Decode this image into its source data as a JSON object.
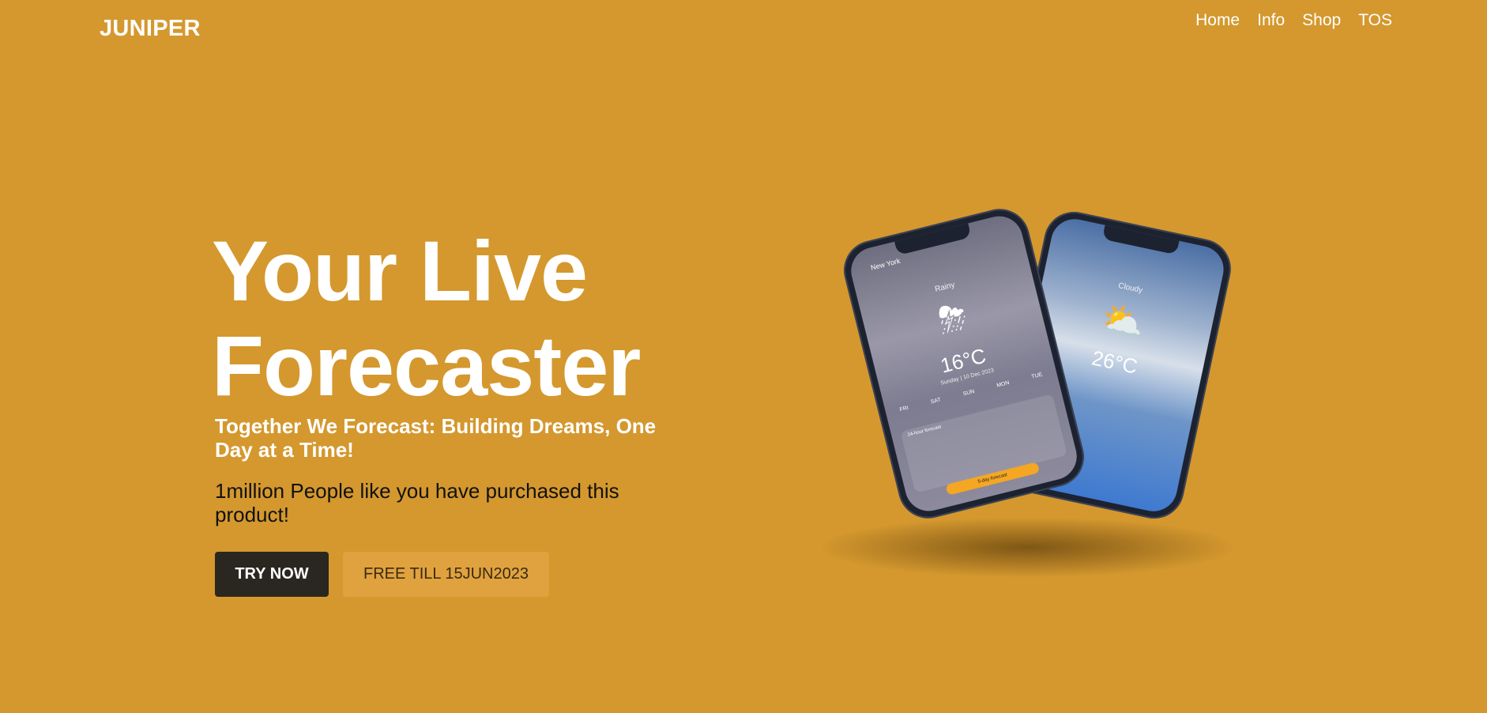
{
  "brand": {
    "logo": "JUNIPER"
  },
  "nav": {
    "items": [
      "Home",
      "Info",
      "Shop",
      "TOS"
    ]
  },
  "hero": {
    "title_line1": "Your Live",
    "title_line2": "Forecaster",
    "tagline": "Together We Forecast: Building Dreams, One Day at a Time!",
    "social_proof": "1million People like you have purchased this product!",
    "cta_primary": "TRY NOW",
    "cta_secondary": "FREE TILL 15JUN2023"
  },
  "phones": {
    "left": {
      "city": "New York",
      "condition": "Rainy",
      "icon": "thunderstorm-icon",
      "temperature": "16°C",
      "date": "Sunday | 10 Dec 2023",
      "days": [
        "FRI",
        "SAT",
        "SUN",
        "MON",
        "TUE"
      ],
      "card_title": "24-hour forecast",
      "button": "5-day forecast"
    },
    "right": {
      "condition": "Cloudy",
      "icon": "partly-cloudy-icon",
      "temperature": "26°C"
    }
  },
  "colors": {
    "background": "#d4982e",
    "primary_button": "#2a2720",
    "secondary_button": "#e0a23f"
  }
}
